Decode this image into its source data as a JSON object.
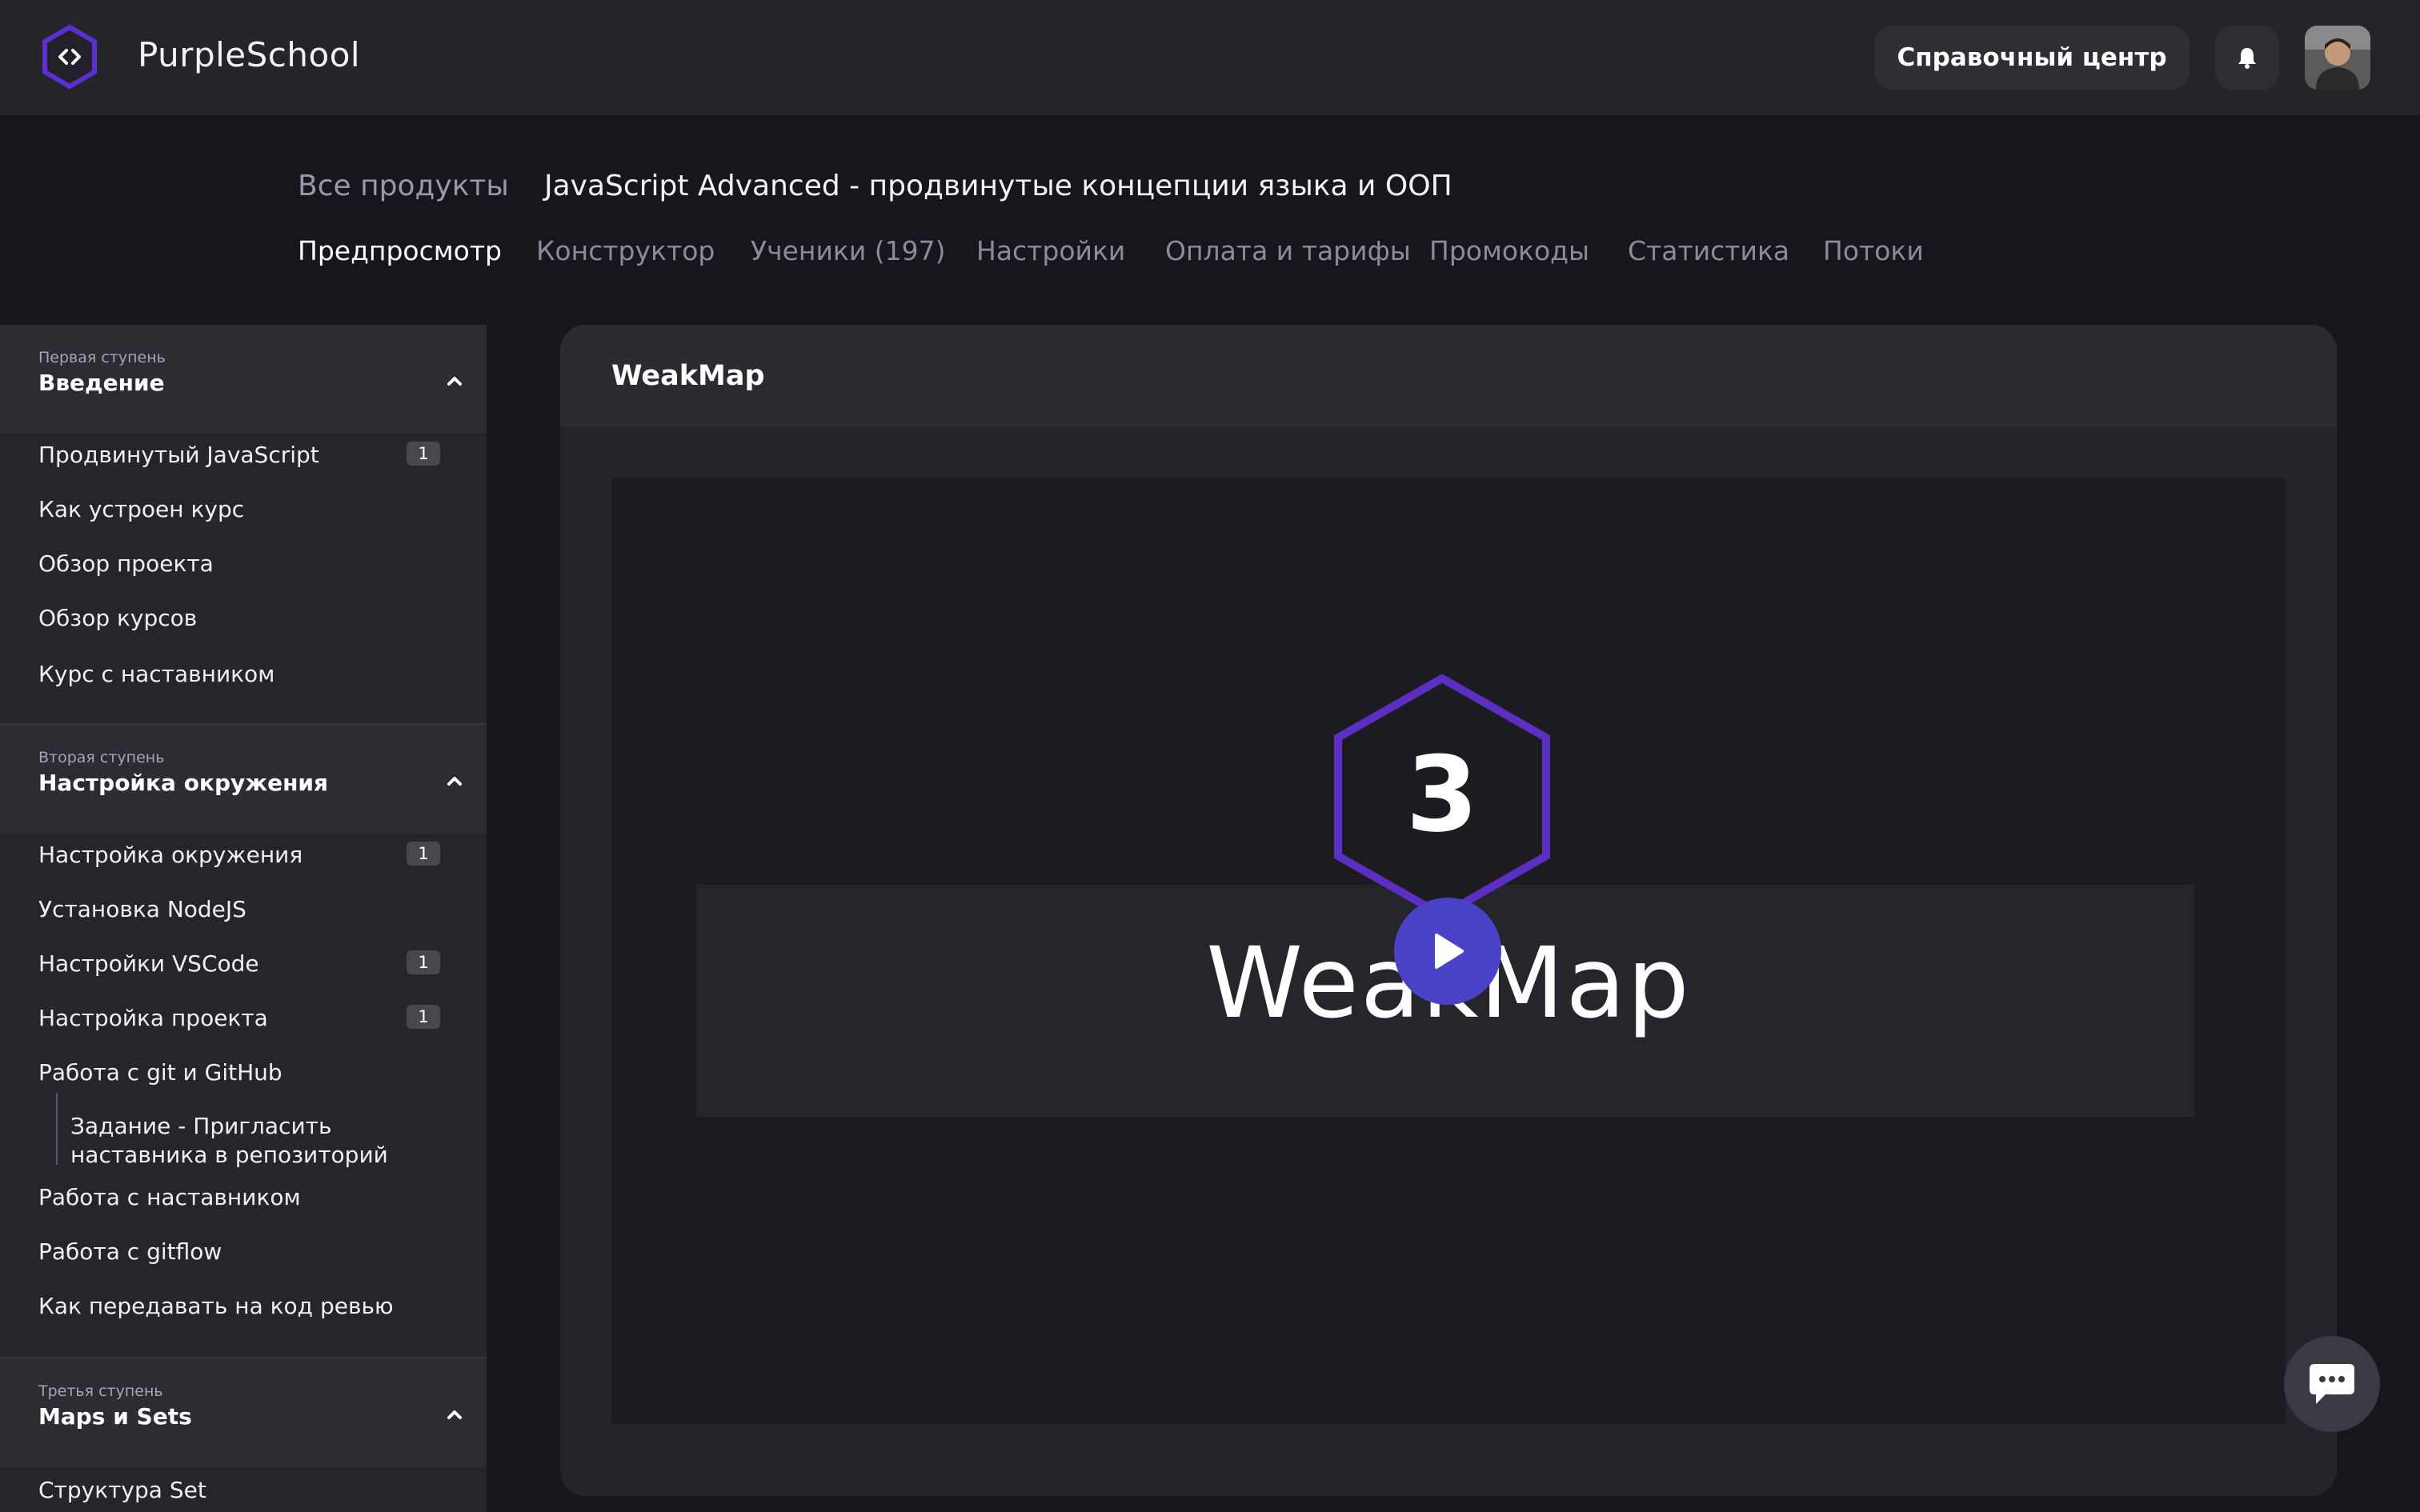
{
  "header": {
    "brand": "PurpleSchool",
    "help_center": "Справочный центр",
    "bell_icon": "bell-icon",
    "avatar": "user-avatar"
  },
  "breadcrumb": {
    "all_products": "Все продукты",
    "current": "JavaScript Advanced - продвинутые концепции языка и ООП"
  },
  "tabs": [
    {
      "label": "Предпросмотр",
      "active": true
    },
    {
      "label": "Конструктор",
      "active": false
    },
    {
      "label": "Ученики (197)",
      "active": false
    },
    {
      "label": "Настройки",
      "active": false
    },
    {
      "label": "Оплата и тарифы",
      "active": false
    },
    {
      "label": "Промокоды",
      "active": false
    },
    {
      "label": "Статистика",
      "active": false
    },
    {
      "label": "Потоки",
      "active": false
    }
  ],
  "sidebar": {
    "sections": [
      {
        "sub": "Первая ступень",
        "title": "Введение",
        "items": [
          {
            "label": "Продвинутый JavaScript",
            "badge": "1"
          },
          {
            "label": "Как устроен курс"
          },
          {
            "label": "Обзор проекта"
          },
          {
            "label": "Обзор курсов"
          },
          {
            "label": "Курс с наставником"
          }
        ]
      },
      {
        "sub": "Вторая ступень",
        "title": "Настройка окружения",
        "items": [
          {
            "label": "Настройка окружения",
            "badge": "1"
          },
          {
            "label": "Установка NodeJS"
          },
          {
            "label": "Настройки VSCode",
            "badge": "1"
          },
          {
            "label": "Настройка проекта",
            "badge": "1"
          },
          {
            "label": "Работа с git и GitHub"
          },
          {
            "label": "Работа с наставником"
          },
          {
            "label": "Работа с gitflow"
          },
          {
            "label": "Как передавать на код ревью"
          }
        ],
        "subtask": [
          "Задание - Пригласить",
          "наставника в репозиторий"
        ]
      },
      {
        "sub": "Третья ступень",
        "title": "Maps и Sets",
        "items": [
          {
            "label": "Структура Set"
          }
        ]
      }
    ]
  },
  "lesson": {
    "title": "WeakMap",
    "video_number": "3",
    "video_title": "WeakMap"
  },
  "colors": {
    "accent": "#5a2fc2",
    "play": "#4b43c7"
  }
}
